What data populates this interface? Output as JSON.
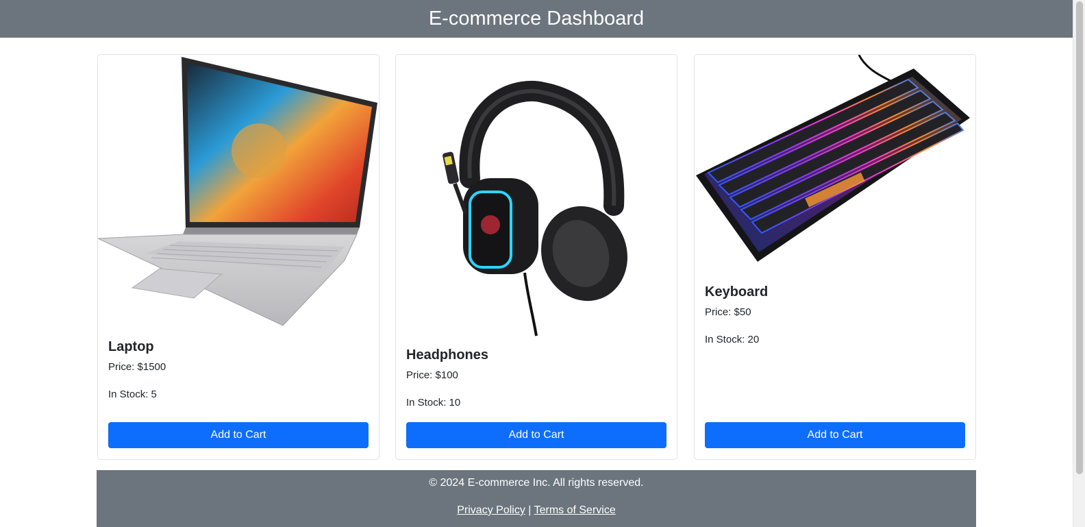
{
  "header": {
    "title": "E-commerce Dashboard"
  },
  "products": [
    {
      "name": "Laptop",
      "price": "Price: $1500",
      "stock": "In Stock: 5",
      "button": "Add to Cart"
    },
    {
      "name": "Headphones",
      "price": "Price: $100",
      "stock": "In Stock: 10",
      "button": "Add to Cart"
    },
    {
      "name": "Keyboard",
      "price": "Price: $50",
      "stock": "In Stock: 20",
      "button": "Add to Cart"
    }
  ],
  "footer": {
    "copyright": "© 2024 E-commerce Inc. All rights reserved.",
    "privacy": "Privacy Policy",
    "separator": "|",
    "terms": "Terms of Service"
  },
  "colors": {
    "header_bg": "#6c757d",
    "button_bg": "#0d6efd",
    "footer_bg": "#6c757d"
  }
}
